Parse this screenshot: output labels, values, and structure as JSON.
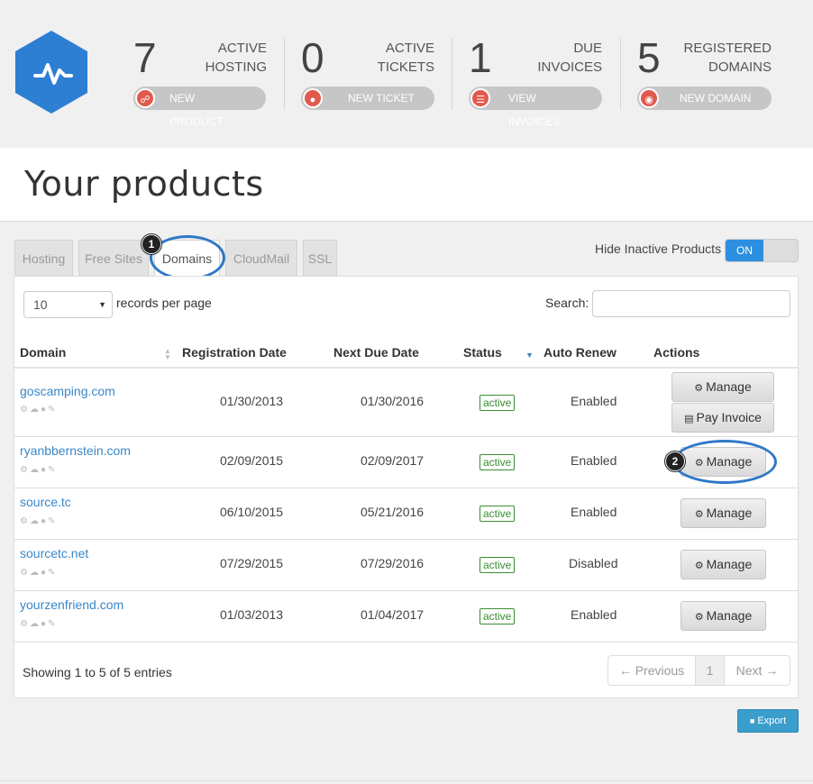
{
  "stats": [
    {
      "number": "7",
      "label_line1": "ACTIVE",
      "label_line2": "HOSTING",
      "button": "NEW PRODUCT",
      "icon": "cart-icon"
    },
    {
      "number": "0",
      "label_line1": "ACTIVE",
      "label_line2": "TICKETS",
      "button": "NEW TICKET",
      "icon": "comment-icon"
    },
    {
      "number": "1",
      "label_line1": "DUE",
      "label_line2": "INVOICES",
      "button": "VIEW INVOICES",
      "icon": "invoice-icon"
    },
    {
      "number": "5",
      "label_line1": "REGISTERED",
      "label_line2": "DOMAINS",
      "button": "NEW DOMAIN",
      "icon": "globe-icon"
    }
  ],
  "page_title": "Your products",
  "tabs": [
    "Hosting",
    "Free Sites",
    "Domains",
    "CloudMail",
    "SSL"
  ],
  "active_tab": "Domains",
  "callouts": [
    "1",
    "2"
  ],
  "toggle": {
    "label": "Hide Inactive Products",
    "state": "ON"
  },
  "table_controls": {
    "records_value": "10",
    "records_label": "records per page",
    "search_label": "Search:"
  },
  "columns": [
    "Domain",
    "Registration Date",
    "Next Due Date",
    "Status",
    "Auto Renew",
    "Actions"
  ],
  "rows": [
    {
      "domain": "goscamping.com",
      "reg": "01/30/2013",
      "due": "01/30/2016",
      "status": "active",
      "renew": "Enabled",
      "actions": [
        "Manage",
        "Pay Invoice"
      ]
    },
    {
      "domain": "ryanbbernstein.com",
      "reg": "02/09/2015",
      "due": "02/09/2017",
      "status": "active",
      "renew": "Enabled",
      "actions": [
        "Manage"
      ]
    },
    {
      "domain": "source.tc",
      "reg": "06/10/2015",
      "due": "05/21/2016",
      "status": "active",
      "renew": "Enabled",
      "actions": [
        "Manage"
      ]
    },
    {
      "domain": "sourcetc.net",
      "reg": "07/29/2015",
      "due": "07/29/2016",
      "status": "active",
      "renew": "Disabled",
      "actions": [
        "Manage"
      ]
    },
    {
      "domain": "yourzenfriend.com",
      "reg": "01/03/2013",
      "due": "01/04/2017",
      "status": "active",
      "renew": "Enabled",
      "actions": [
        "Manage"
      ]
    }
  ],
  "footer": {
    "showing": "Showing 1 to 5 of 5 entries",
    "prev": "← Previous",
    "page": "1",
    "next": "Next →"
  },
  "export_label": "Export",
  "colors": {
    "accent_blue": "#2e78c7",
    "logo_blue": "#2d7fd3",
    "status_green": "#3a8d33",
    "pill_icon_red": "#e05a4e"
  }
}
